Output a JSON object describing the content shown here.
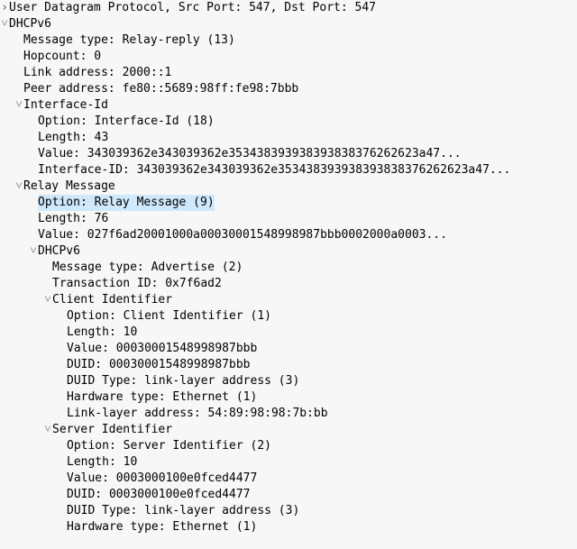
{
  "udp_line": "User Datagram Protocol, Src Port: 547, Dst Port: 547",
  "dhcpv6_label": "DHCPv6",
  "msg_type": "Message type: Relay-reply (13)",
  "hopcount": "Hopcount: 0",
  "link_addr": "Link address: 2000::1",
  "peer_addr": "Peer address: fe80::5689:98ff:fe98:7bbb",
  "iface_id": {
    "label": "Interface-Id",
    "option": "Option: Interface-Id (18)",
    "length": "Length: 43",
    "value": "Value: 343039362e343039362e353438393938393838376262623a47...",
    "iface": "Interface-ID: 343039362e343039362e353438393938393838376262623a47..."
  },
  "relay": {
    "label": "Relay Message",
    "option": "Option: Relay Message (9)",
    "length": "Length: 76",
    "value": "Value: 027f6ad20001000a00030001548998987bbb0002000a0003...",
    "dhcpv6_label": "DHCPv6",
    "msg_type": "Message type: Advertise (2)",
    "trans_id": "Transaction ID: 0x7f6ad2",
    "client": {
      "label": "Client Identifier",
      "option": "Option: Client Identifier (1)",
      "length": "Length: 10",
      "value": "Value: 00030001548998987bbb",
      "duid": "DUID: 00030001548998987bbb",
      "duid_type": "DUID Type: link-layer address (3)",
      "hw_type": "Hardware type: Ethernet (1)",
      "ll_addr": "Link-layer address: 54:89:98:98:7b:bb"
    },
    "server": {
      "label": "Server Identifier",
      "option": "Option: Server Identifier (2)",
      "length": "Length: 10",
      "value": "Value: 0003000100e0fced4477",
      "duid": "DUID: 0003000100e0fced4477",
      "duid_type": "DUID Type: link-layer address (3)",
      "hw_type": "Hardware type: Ethernet (1)"
    }
  },
  "glyph": {
    "open": "˅",
    "closed": "›"
  }
}
